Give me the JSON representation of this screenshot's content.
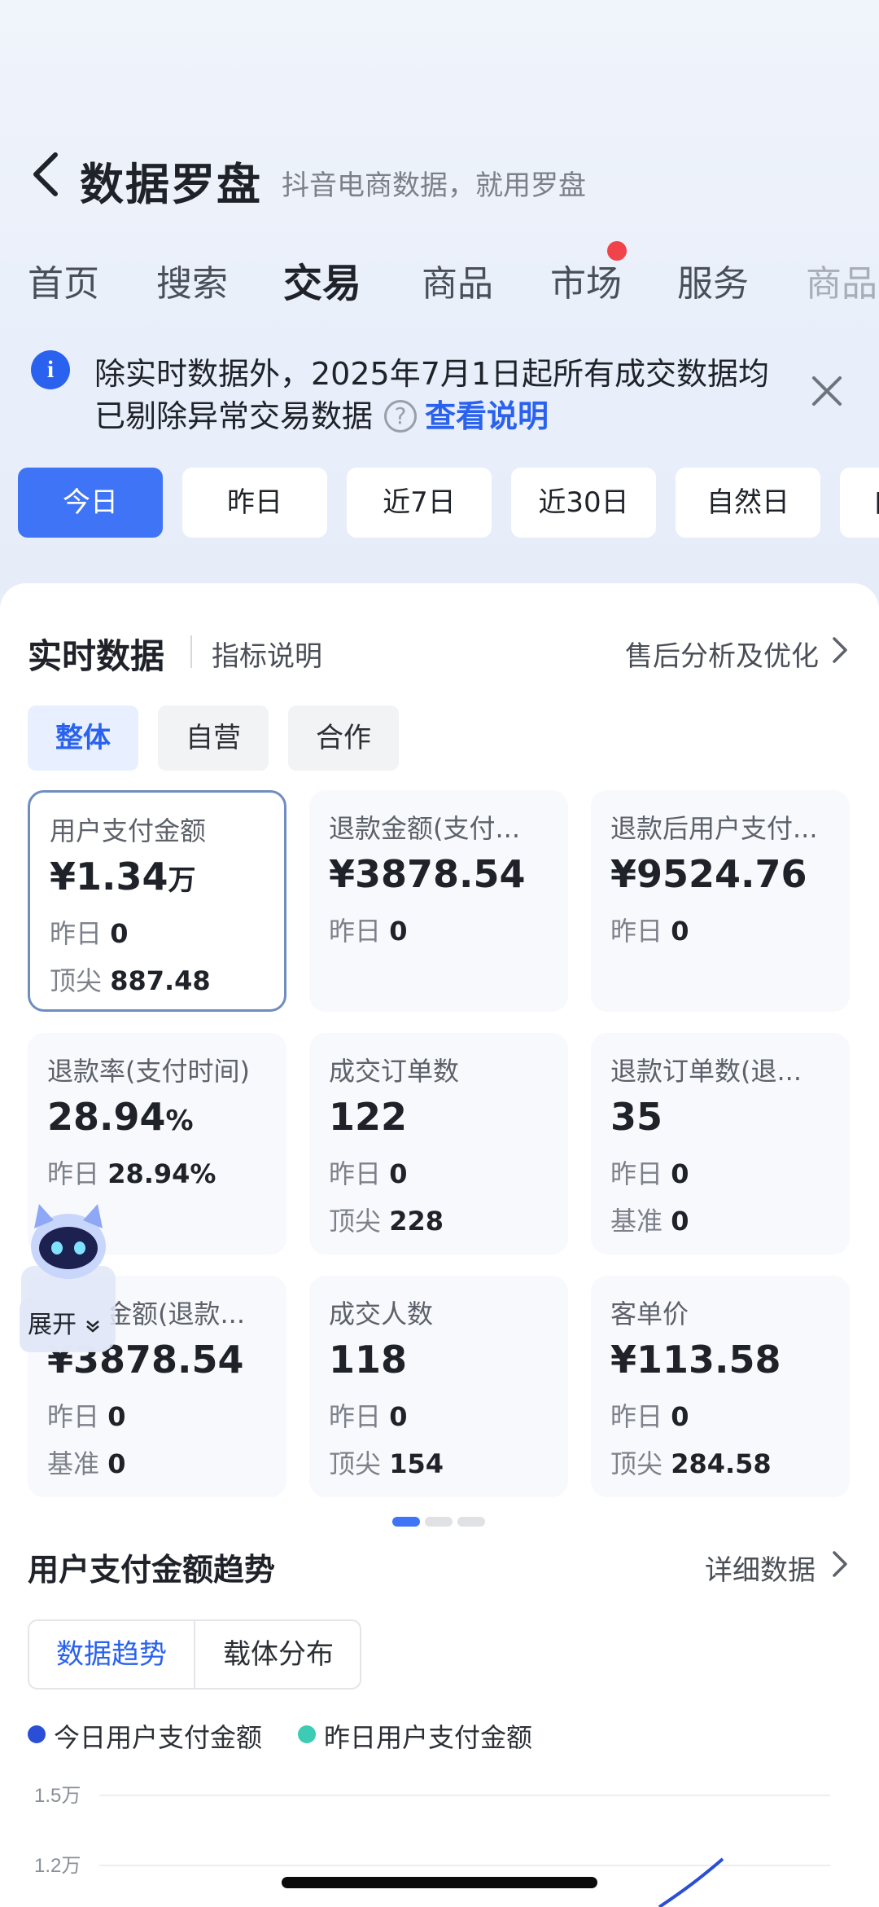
{
  "header": {
    "title": "数据罗盘",
    "subtitle": "抖音电商数据，就用罗盘"
  },
  "tabs": [
    "首页",
    "搜索",
    "交易",
    "商品",
    "市场",
    "服务",
    "商品"
  ],
  "active_tab": "交易",
  "notice": {
    "line1": "除实时数据外，2025年7月1日起所有成交数据均",
    "line2": "已剔除异常交易数据",
    "help": "?",
    "link": "查看说明"
  },
  "date_filters": [
    "今日",
    "昨日",
    "近7日",
    "近30日",
    "自然日",
    "自"
  ],
  "realtime": {
    "title": "实时数据",
    "indicator_link": "指标说明",
    "after_sales_link": "售后分析及优化",
    "segments": [
      "整体",
      "自营",
      "合作"
    ],
    "metrics": [
      {
        "label": "用户支付金额",
        "value": "¥1.34",
        "unit": "万",
        "row1_label": "昨日",
        "row1_value": "0",
        "row2_label": "顶尖",
        "row2_value": "887.48"
      },
      {
        "label": "退款金额(支付...",
        "value": "¥3878.54",
        "unit": "",
        "row1_label": "昨日",
        "row1_value": "0",
        "row2_label": "",
        "row2_value": ""
      },
      {
        "label": "退款后用户支付...",
        "value": "¥9524.76",
        "unit": "",
        "row1_label": "昨日",
        "row1_value": "0",
        "row2_label": "",
        "row2_value": ""
      },
      {
        "label": "退款率(支付时间)",
        "value": "28.94",
        "unit": "%",
        "row1_label": "昨日",
        "row1_value": "28.94%",
        "row2_label": "",
        "row2_value": ""
      },
      {
        "label": "成交订单数",
        "value": "122",
        "unit": "",
        "row1_label": "昨日",
        "row1_value": "0",
        "row2_label": "顶尖",
        "row2_value": "228"
      },
      {
        "label": "退款订单数(退...",
        "value": "35",
        "unit": "",
        "row1_label": "昨日",
        "row1_value": "0",
        "row2_label": "基准",
        "row2_value": "0"
      },
      {
        "label": "金额(退款...",
        "value": "¥3878.54",
        "unit": "",
        "row1_label": "昨日",
        "row1_value": "0",
        "row2_label": "基准",
        "row2_value": "0"
      },
      {
        "label": "成交人数",
        "value": "118",
        "unit": "",
        "row1_label": "昨日",
        "row1_value": "0",
        "row2_label": "顶尖",
        "row2_value": "154"
      },
      {
        "label": "客单价",
        "value": "¥113.58",
        "unit": "",
        "row1_label": "昨日",
        "row1_value": "0",
        "row2_label": "顶尖",
        "row2_value": "284.58"
      }
    ]
  },
  "trend": {
    "title": "用户支付金额趋势",
    "detail_link": "详细数据",
    "tabs": [
      "数据趋势",
      "载体分布"
    ],
    "legend": [
      {
        "label": "今日用户支付金额",
        "color": "#2a4fd6"
      },
      {
        "label": "昨日用户支付金额",
        "color": "#3ccbb4"
      }
    ],
    "y_ticks": [
      "1.5万",
      "1.2万"
    ]
  },
  "assistant": {
    "expand_label": "展开"
  },
  "colors": {
    "accent": "#3f74f6",
    "link": "#2a62ef",
    "badge": "#f0434a"
  }
}
